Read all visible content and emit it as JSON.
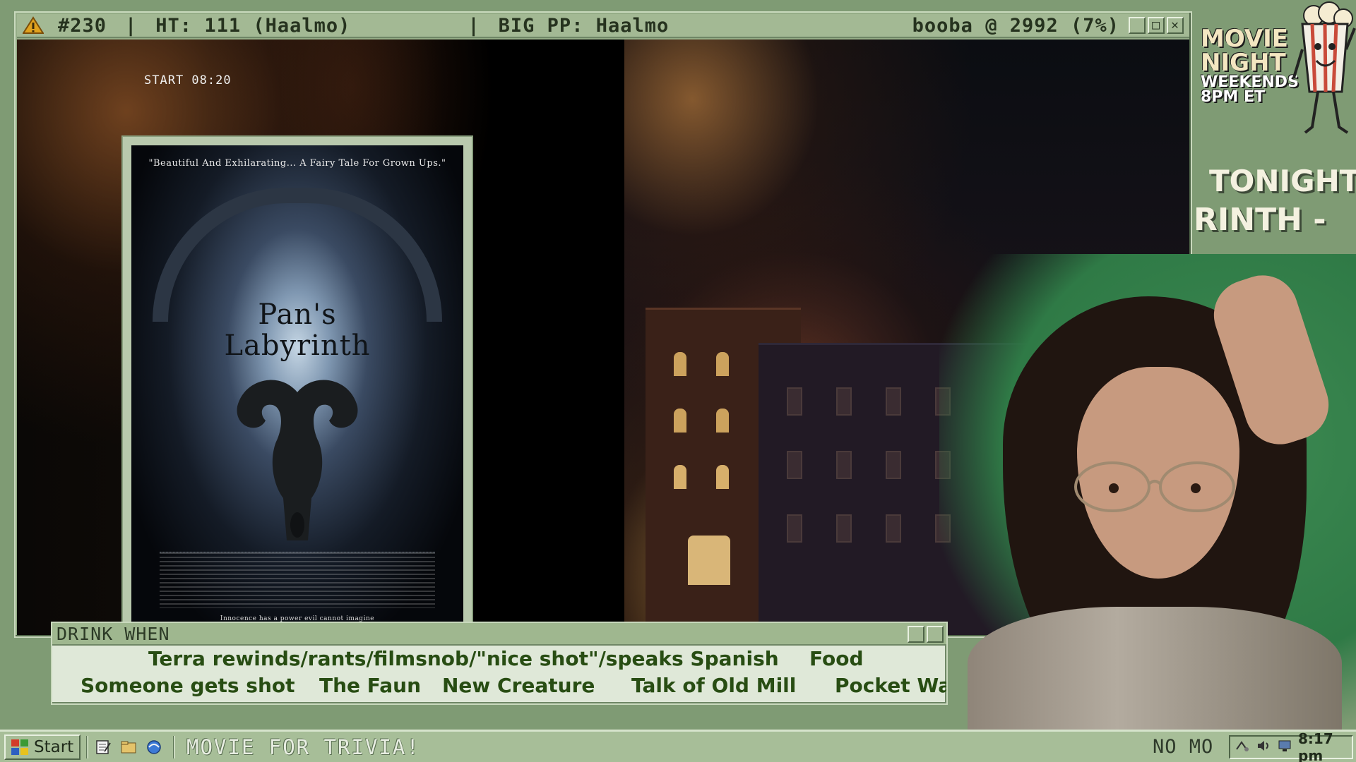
{
  "title_bar": {
    "count": "#230",
    "ht": "HT: 111 (Haalmo)",
    "big_pp": "BIG PP: Haalmo",
    "booba": "booba @ 2992 (7%)",
    "buttons": [
      "minimize",
      "maximize",
      "close"
    ]
  },
  "video": {
    "start_time": "START 08:20"
  },
  "poster": {
    "tagline": "\"Beautiful And Exhilarating... A Fairy Tale For Grown Ups.\"",
    "title_line1": "Pan's",
    "title_line2": "Labyrinth",
    "bottom_line": "Innocence has a power evil cannot imagine"
  },
  "drink_panel": {
    "title": "DRINK WHEN",
    "row1": [
      "Terra rewinds/rants/filmsnob/\"nice shot\"/speaks Spanish",
      "Food"
    ],
    "row2": [
      "Someone gets shot",
      "The Faun",
      "New Creature",
      "Talk of Old Mill",
      "Pocket Wa"
    ]
  },
  "sidebar": {
    "logo_line1": "MOVIE",
    "logo_line2": "NIGHT",
    "logo_line3": "WEEKENDS",
    "logo_line4": "8PM ET",
    "tonight_label": "TONIGHT:",
    "tonight_marquee": "RINTH -"
  },
  "taskbar": {
    "start_label": "Start",
    "ticker": "MOVIE FOR TRIVIA!",
    "tray_text": "NO MO",
    "clock": "8:17 pm"
  },
  "colors": {
    "frame_green": "#95ad87",
    "drink_text": "#284d13",
    "taskbar": "#a7be98"
  }
}
